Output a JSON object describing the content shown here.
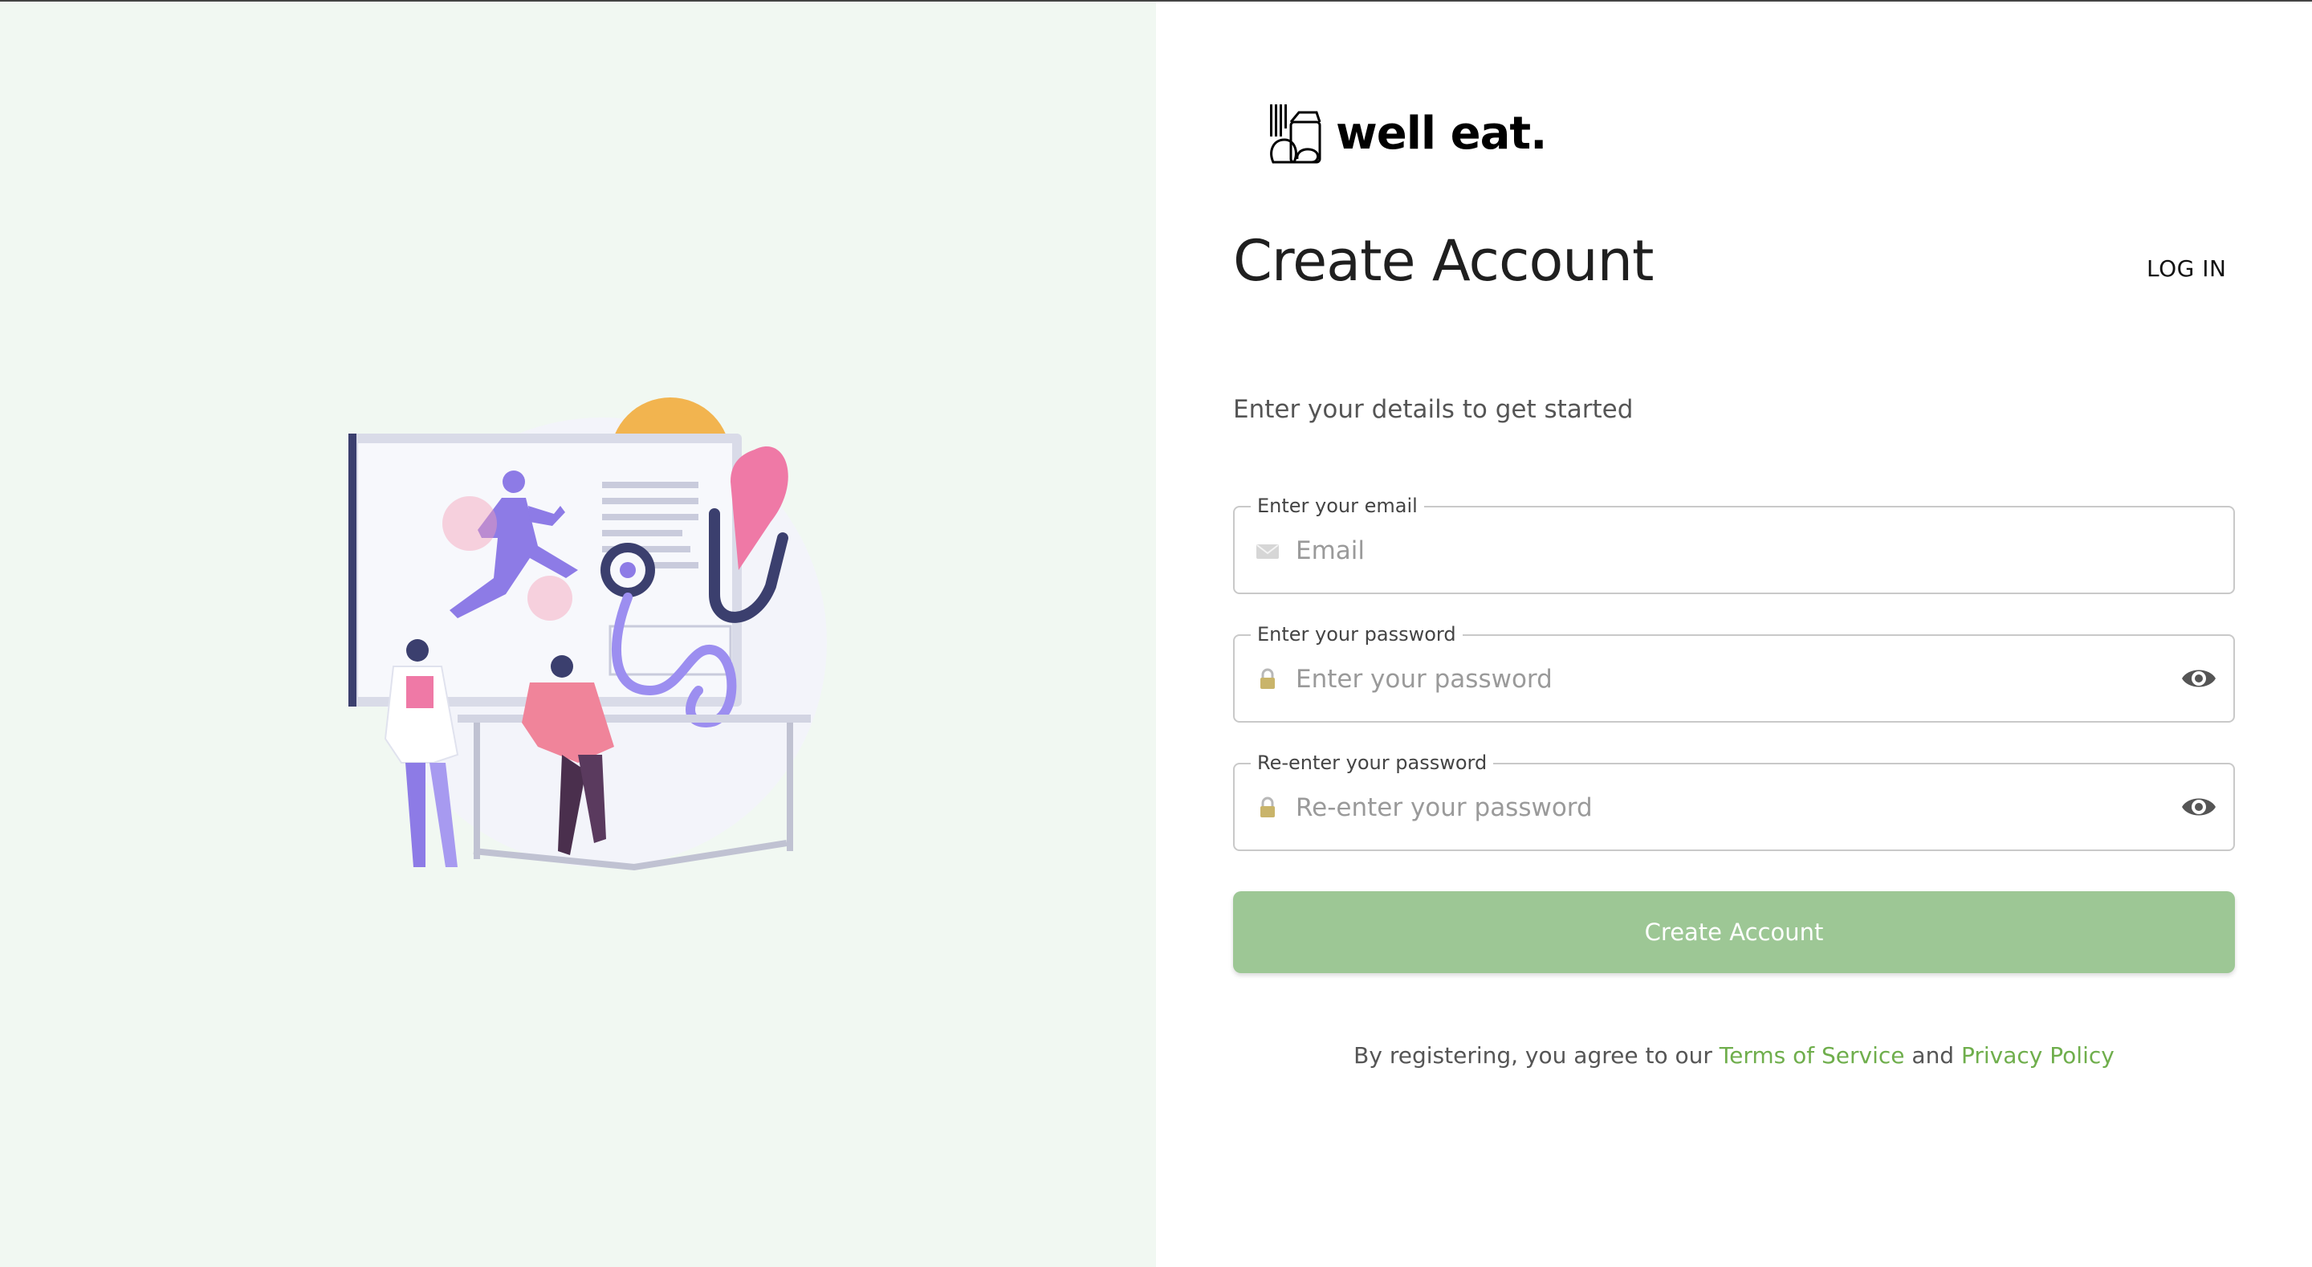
{
  "brand": {
    "name": "well eat."
  },
  "header": {
    "title": "Create Account",
    "login_label": "LOG IN"
  },
  "form": {
    "subtitle": "Enter your details to get started",
    "email": {
      "label": "Enter your email",
      "placeholder": "Email",
      "icon": "mail-icon"
    },
    "password": {
      "label": "Enter your password",
      "placeholder": "Enter your password",
      "icon": "lock-icon",
      "toggle_icon": "eye-icon"
    },
    "confirm_password": {
      "label": "Re-enter your password",
      "placeholder": "Re-enter your password",
      "icon": "lock-icon",
      "toggle_icon": "eye-icon"
    },
    "submit_label": "Create Account"
  },
  "legal": {
    "prefix": "By registering, you agree to our",
    "terms": "Terms of Service",
    "conjunction": "and",
    "privacy": "Privacy Policy"
  },
  "colors": {
    "left_panel_bg": "#f1f8f2",
    "button_bg": "#9dc795",
    "link": "#6fae4c"
  }
}
